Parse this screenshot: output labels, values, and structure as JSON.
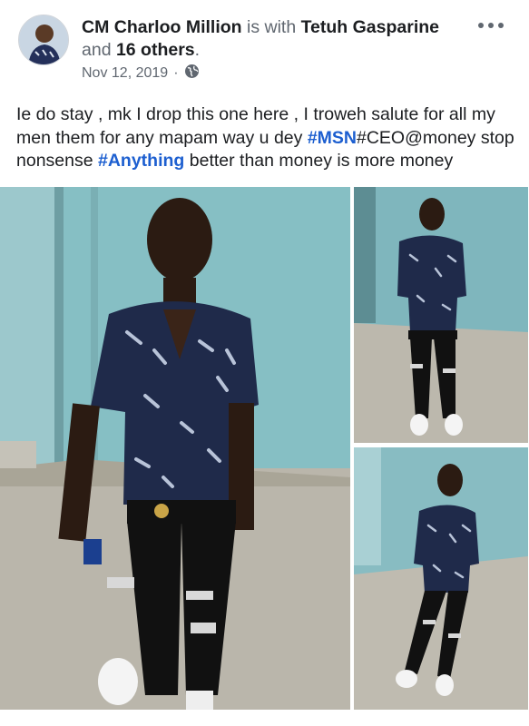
{
  "post": {
    "author": "CM Charloo Million",
    "with_text": " is with ",
    "tagged_person": "Tetuh Gasparine",
    "and_text": "and ",
    "others": "16 others",
    "period": ".",
    "date": "Nov 12, 2019",
    "dot": "·",
    "privacy_icon": "globe-icon",
    "more_icon": "more-options-icon"
  },
  "content": {
    "part1": "Ie do stay , mk I drop this one here , I troweh salute for all my men them for any mapam way u dey ",
    "hashtag1": "#MSN",
    "part2": "#CEO@money stop nonsense ",
    "hashtag2": "#Anything",
    "part3": " better than money is more money"
  },
  "photos": [
    {
      "name": "main-photo",
      "description": "man in patterned shirt against teal wall"
    },
    {
      "name": "photo-2"
    },
    {
      "name": "photo-3"
    }
  ],
  "colors": {
    "link": "#1d5fd0",
    "wall": "#7fb8be",
    "floor": "#b9b4a8",
    "shirt": "#1f2a4a"
  }
}
